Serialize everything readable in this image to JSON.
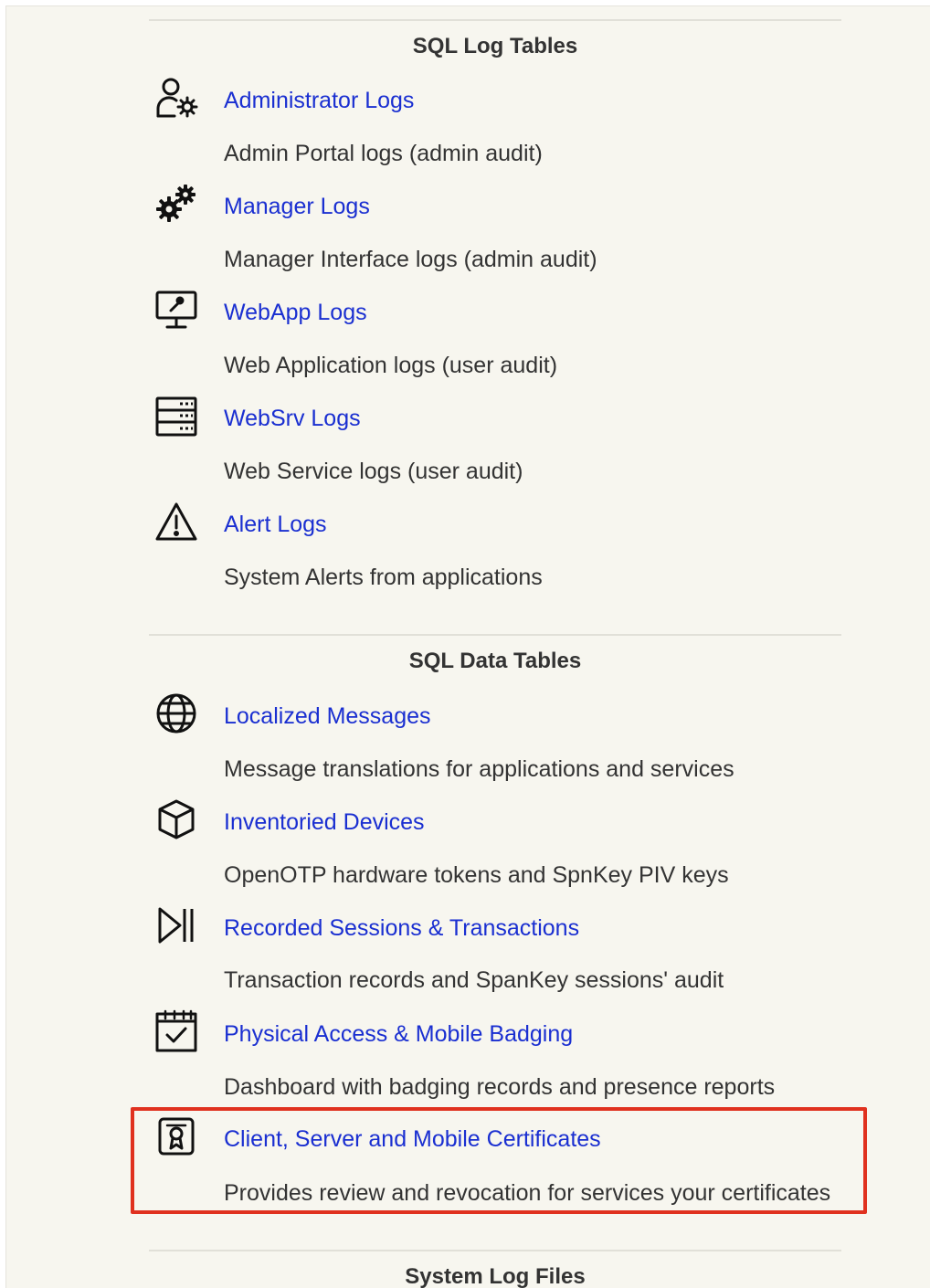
{
  "sections": [
    {
      "title": "SQL Log Tables",
      "items": [
        {
          "icon": "admin-user-gear-icon",
          "label": "Administrator Logs",
          "description": "Admin Portal logs (admin audit)"
        },
        {
          "icon": "gears-icon",
          "label": "Manager Logs",
          "description": "Manager Interface logs (admin audit)"
        },
        {
          "icon": "monitor-key-icon",
          "label": "WebApp Logs",
          "description": "Web Application logs (user audit)"
        },
        {
          "icon": "server-rack-icon",
          "label": "WebSrv Logs",
          "description": "Web Service logs (user audit)"
        },
        {
          "icon": "alert-triangle-icon",
          "label": "Alert Logs",
          "description": "System Alerts from applications"
        }
      ]
    },
    {
      "title": "SQL Data Tables",
      "items": [
        {
          "icon": "globe-icon",
          "label": "Localized Messages",
          "description": "Message translations for applications and services"
        },
        {
          "icon": "cube-icon",
          "label": "Inventoried Devices",
          "description": "OpenOTP hardware tokens and SpnKey PIV keys"
        },
        {
          "icon": "play-pause-icon",
          "label": "Recorded Sessions & Transactions",
          "description": "Transaction records and SpanKey sessions' audit"
        },
        {
          "icon": "calendar-check-icon",
          "label": "Physical Access & Mobile Badging",
          "description": "Dashboard with badging records and presence reports"
        },
        {
          "icon": "certificate-icon",
          "label": "Client, Server and Mobile Certificates",
          "description": "Provides review and revocation for services your certificates",
          "highlighted": true
        }
      ]
    },
    {
      "title": "System Log Files",
      "items": []
    }
  ],
  "colors": {
    "link": "#1a2fd1",
    "text": "#333333",
    "background": "#f7f6ef",
    "highlight_border": "#e0311f"
  }
}
